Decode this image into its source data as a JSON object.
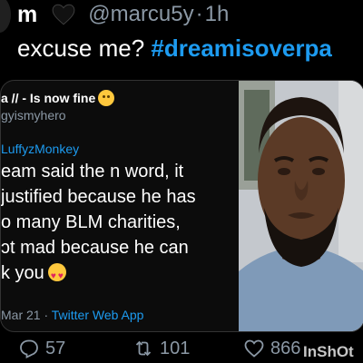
{
  "tweet": {
    "name": "m",
    "handle": "@marcu5y",
    "separator": "·",
    "time": "1h",
    "text_prefix": "excuse me? ",
    "hashtag": "#dreamisoverpa"
  },
  "quote": {
    "name_fragment": "a // - Is now fine",
    "handle_fragment": "gyismyhero",
    "reply_to": "LuffyzMonkey",
    "body_lines": [
      "eam said the n word, it",
      "justified because he has",
      "o many BLM charities,",
      "ɔt mad because he can",
      "k you"
    ],
    "date": "Mar 21",
    "separator": " · ",
    "app": "Twitter Web App"
  },
  "actions": {
    "replies": "57",
    "retweets": "101",
    "likes": "866"
  },
  "watermark": "InShOt",
  "icons": {
    "heart": "black-heart-icon",
    "reply": "reply-icon",
    "retweet": "retweet-icon",
    "like": "like-icon",
    "emoji_upside_down": "upside-down-face-icon",
    "emoji_heart_eyes": "heart-eyes-icon"
  },
  "colors": {
    "background": "#000000",
    "link": "#1d9bf0",
    "muted": "#8b98a5"
  }
}
